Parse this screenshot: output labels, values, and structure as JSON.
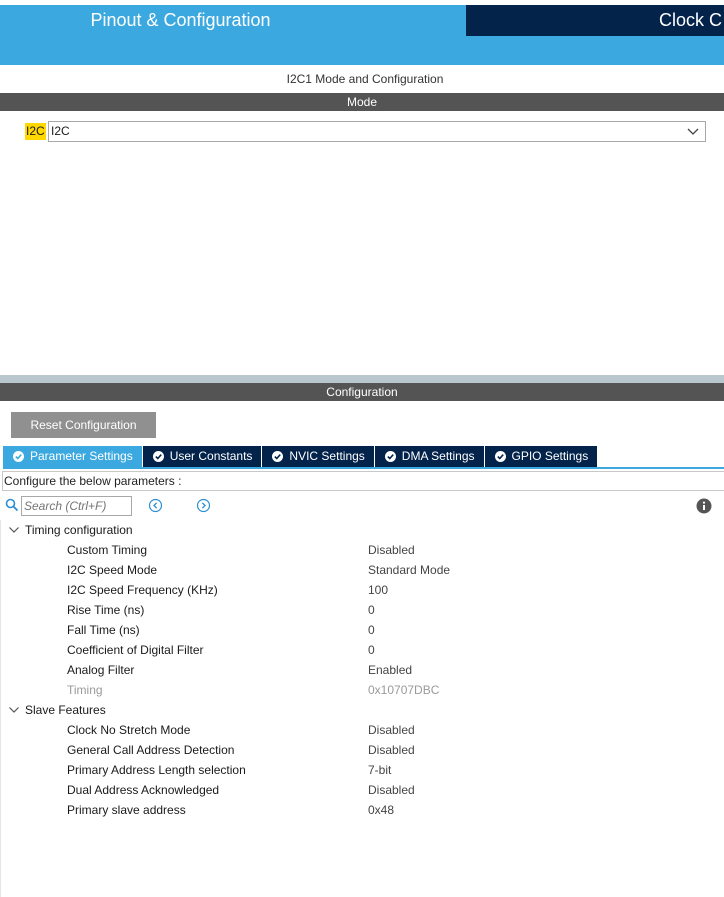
{
  "header": {
    "pinout_tab": "Pinout & Configuration",
    "clock_tab": "Clock C"
  },
  "panel_title": "I2C1 Mode and Configuration",
  "mode": {
    "section_label": "Mode",
    "field_label": "I2C",
    "selected": "I2C"
  },
  "configuration": {
    "section_label": "Configuration",
    "reset_button": "Reset Configuration",
    "tabs": [
      {
        "label": "Parameter Settings",
        "active": true
      },
      {
        "label": "User Constants",
        "active": false
      },
      {
        "label": "NVIC Settings",
        "active": false
      },
      {
        "label": "DMA Settings",
        "active": false
      },
      {
        "label": "GPIO Settings",
        "active": false
      }
    ],
    "caption": "Configure the below parameters :",
    "search_placeholder": "Search (Ctrl+F)",
    "groups": [
      {
        "label": "Timing configuration",
        "params": [
          {
            "name": "Custom Timing",
            "value": "Disabled"
          },
          {
            "name": "I2C Speed Mode",
            "value": "Standard Mode"
          },
          {
            "name": "I2C Speed Frequency (KHz)",
            "value": "100"
          },
          {
            "name": "Rise Time (ns)",
            "value": "0"
          },
          {
            "name": "Fall Time (ns)",
            "value": "0"
          },
          {
            "name": "Coefficient of Digital Filter",
            "value": "0"
          },
          {
            "name": "Analog Filter",
            "value": "Enabled"
          },
          {
            "name": "Timing",
            "value": "0x10707DBC"
          }
        ]
      },
      {
        "label": "Slave Features",
        "params": [
          {
            "name": "Clock No Stretch Mode",
            "value": "Disabled"
          },
          {
            "name": "General Call Address Detection",
            "value": "Disabled"
          },
          {
            "name": "Primary Address Length selection",
            "value": "7-bit"
          },
          {
            "name": "Dual Address Acknowledged",
            "value": "Disabled"
          },
          {
            "name": "Primary slave address",
            "value": "0x48"
          }
        ]
      }
    ]
  },
  "colors": {
    "header_blue": "#3ba9e0",
    "header_navy": "#03234b",
    "section_gray": "#545454",
    "highlight_yellow": "#ffd800"
  }
}
